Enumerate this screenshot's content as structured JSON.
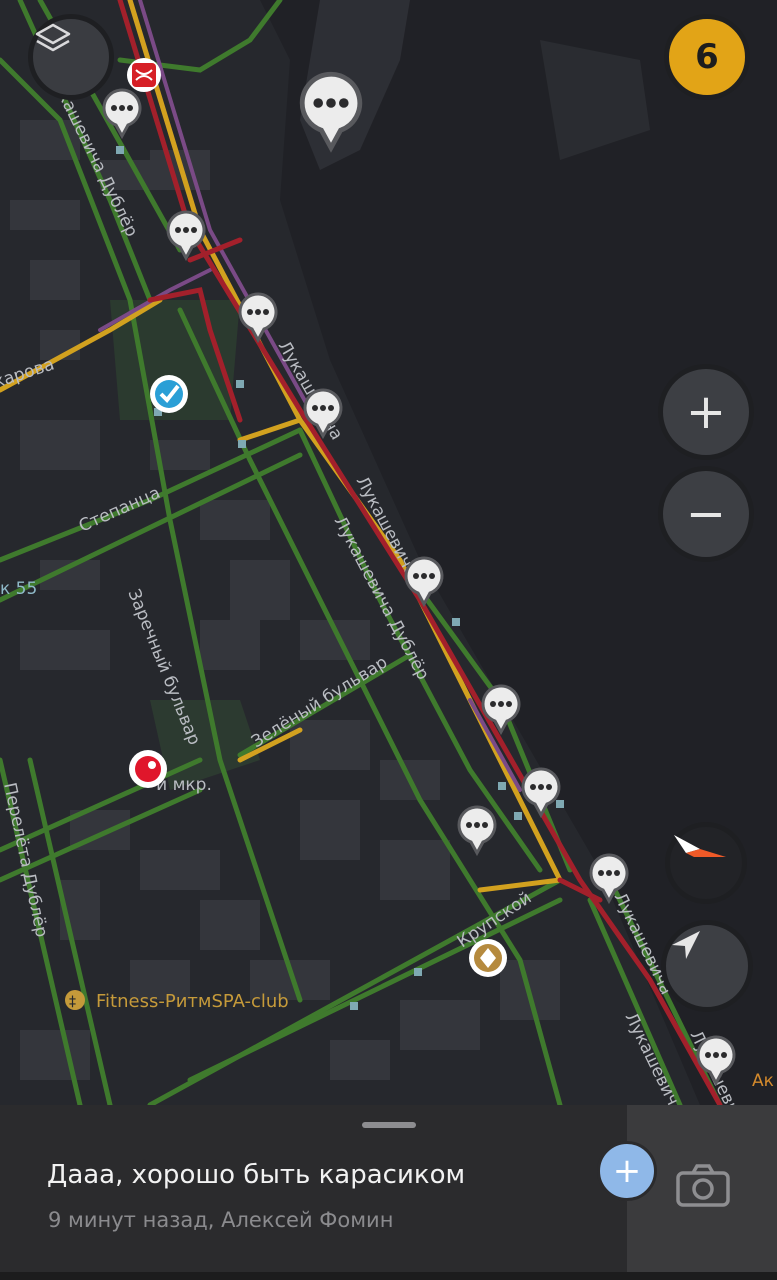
{
  "map": {
    "street_labels": [
      {
        "text": "Лукашевича Дублёр"
      },
      {
        "text": "Лукашевича"
      },
      {
        "text": "Лукашевича"
      },
      {
        "text": "Лукашевича Дублёр"
      },
      {
        "text": "Степанца"
      },
      {
        "text": "Заречный бульвар"
      },
      {
        "text": "Зелёный бульвар"
      },
      {
        "text": "Перелёта Дублёр"
      },
      {
        "text": "Крупской"
      },
      {
        "text": "Лукашевича"
      },
      {
        "text": "Лукашевич"
      },
      {
        "text": "Лукашевич"
      },
      {
        "text": "карова"
      },
      {
        "text": "к 55"
      },
      {
        "text": "-й мкр."
      },
      {
        "text": "Ак"
      }
    ],
    "poi_labels": [
      {
        "text": "Fitness-РитмSPA-club"
      }
    ],
    "traffic_colors": {
      "green": "#3f7a2d",
      "yellow": "#d2a11f",
      "red": "#a3202b",
      "purple": "#7a4a86"
    }
  },
  "controls": {
    "layers_icon": "layers-icon",
    "traffic_score": "6",
    "zoom_in_label": "+",
    "zoom_out_label": "−",
    "compass_icon": "compass-icon",
    "locate_icon": "navigation-arrow-icon"
  },
  "bottom_sheet": {
    "title": "Дааа, хорошо быть карасиком",
    "subtitle": "9 минут назад, Алексей Фомин",
    "add_label": "+",
    "camera_icon": "camera-icon"
  }
}
